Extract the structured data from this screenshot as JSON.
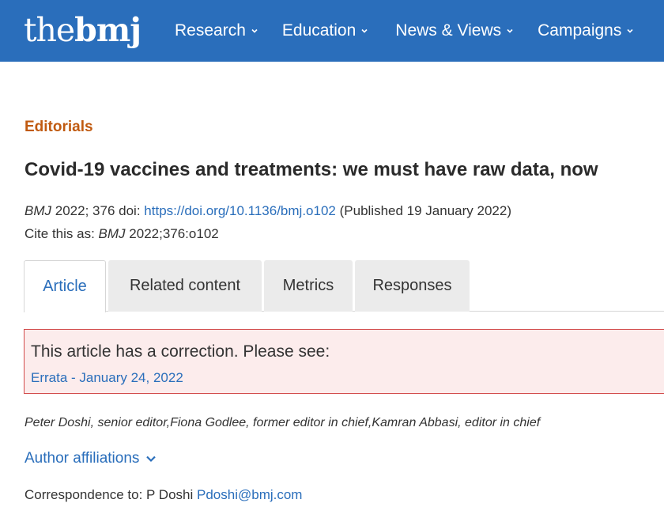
{
  "header": {
    "logo_part1": "the",
    "logo_part2": "bmj",
    "nav": [
      {
        "label": "Research"
      },
      {
        "label": "Education"
      },
      {
        "label": "News & Views"
      },
      {
        "label": "Campaigns"
      }
    ],
    "background_color": "#2a6ebb"
  },
  "article": {
    "section": "Editorials",
    "title": "Covid-19 vaccines and treatments: we must have raw data, now",
    "citation": {
      "journal": "BMJ",
      "year": "2022",
      "sep": ";",
      "volume": "376",
      "doi_label": "doi:",
      "doi_url": "https://doi.org/10.1136/bmj.o102",
      "published": "(Published 19 January 2022)",
      "cite_label": "Cite this as:",
      "cite_journal": "BMJ",
      "cite_ref": "2022;376:o102"
    },
    "tabs": [
      {
        "label": "Article",
        "active": true
      },
      {
        "label": "Related content",
        "active": false
      },
      {
        "label": "Metrics",
        "active": false
      },
      {
        "label": "Responses",
        "active": false
      }
    ],
    "correction": {
      "message": "This article has a correction. Please see:",
      "link_label": "Errata - January 24, 2022"
    },
    "authors": "Peter Doshi, senior editor,Fiona Godlee, former editor in chief,Kamran Abbasi, editor in chief",
    "affiliations_label": "Author affiliations",
    "correspondence": {
      "label": "Correspondence to: P Doshi",
      "email": "Pdoshi@bmj.com"
    }
  },
  "colors": {
    "accent": "#2a6ebb",
    "section": "#c05a10",
    "correction_border": "#d24b4b",
    "correction_bg": "#fcecec"
  },
  "icons": [
    "chevron-down-icon"
  ]
}
